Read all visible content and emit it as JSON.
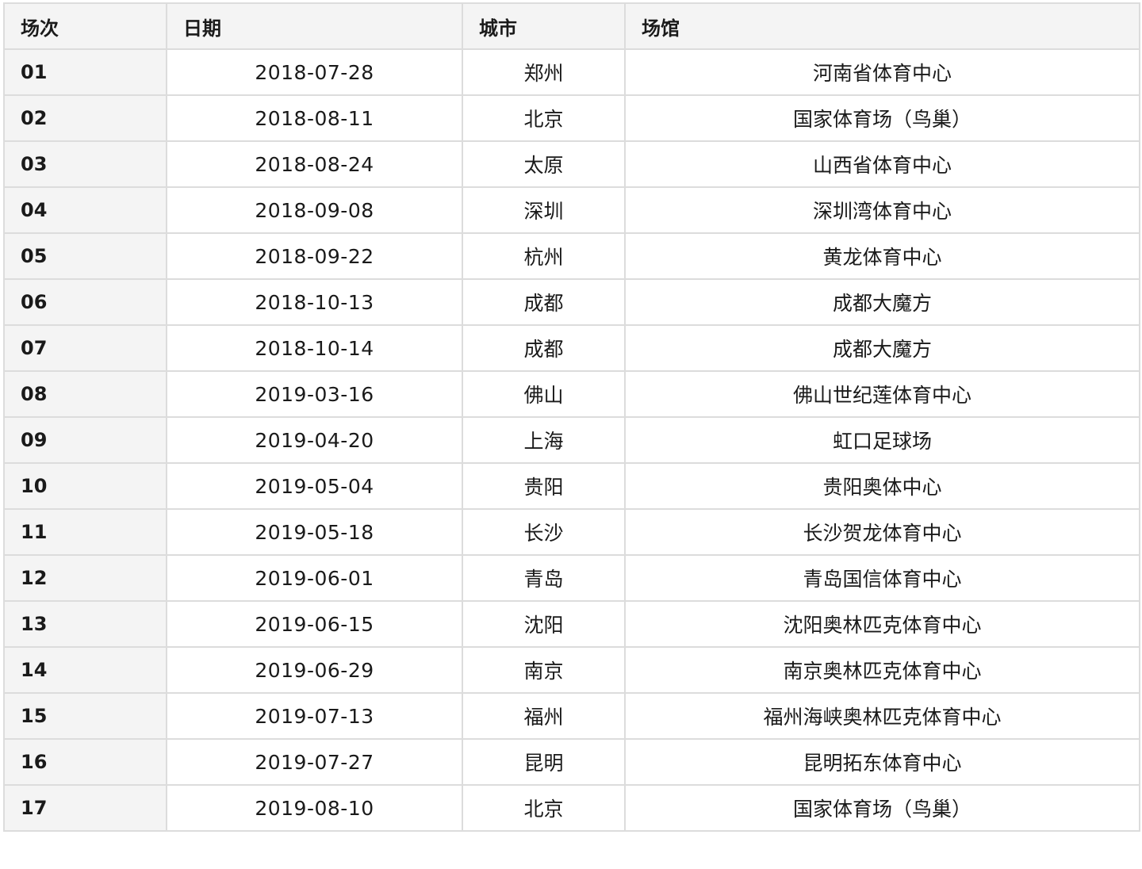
{
  "table": {
    "headers": {
      "round": "场次",
      "date": "日期",
      "city": "城市",
      "venue": "场馆"
    },
    "rows": [
      {
        "round": "01",
        "date": "2018-07-28",
        "city": "郑州",
        "venue": "河南省体育中心"
      },
      {
        "round": "02",
        "date": "2018-08-11",
        "city": "北京",
        "venue": "国家体育场（鸟巢）"
      },
      {
        "round": "03",
        "date": "2018-08-24",
        "city": "太原",
        "venue": "山西省体育中心"
      },
      {
        "round": "04",
        "date": "2018-09-08",
        "city": "深圳",
        "venue": "深圳湾体育中心"
      },
      {
        "round": "05",
        "date": "2018-09-22",
        "city": "杭州",
        "venue": "黄龙体育中心"
      },
      {
        "round": "06",
        "date": "2018-10-13",
        "city": "成都",
        "venue": "成都大魔方"
      },
      {
        "round": "07",
        "date": "2018-10-14",
        "city": "成都",
        "venue": "成都大魔方"
      },
      {
        "round": "08",
        "date": "2019-03-16",
        "city": "佛山",
        "venue": "佛山世纪莲体育中心"
      },
      {
        "round": "09",
        "date": "2019-04-20",
        "city": "上海",
        "venue": "虹口足球场"
      },
      {
        "round": "10",
        "date": "2019-05-04",
        "city": "贵阳",
        "venue": "贵阳奥体中心"
      },
      {
        "round": "11",
        "date": "2019-05-18",
        "city": "长沙",
        "venue": "长沙贺龙体育中心"
      },
      {
        "round": "12",
        "date": "2019-06-01",
        "city": "青岛",
        "venue": "青岛国信体育中心"
      },
      {
        "round": "13",
        "date": "2019-06-15",
        "city": "沈阳",
        "venue": "沈阳奥林匹克体育中心"
      },
      {
        "round": "14",
        "date": "2019-06-29",
        "city": "南京",
        "venue": "南京奥林匹克体育中心"
      },
      {
        "round": "15",
        "date": "2019-07-13",
        "city": "福州",
        "venue": "福州海峡奥林匹克体育中心"
      },
      {
        "round": "16",
        "date": "2019-07-27",
        "city": "昆明",
        "venue": "昆明拓东体育中心"
      },
      {
        "round": "17",
        "date": "2019-08-10",
        "city": "北京",
        "venue": "国家体育场（鸟巢）"
      }
    ]
  }
}
